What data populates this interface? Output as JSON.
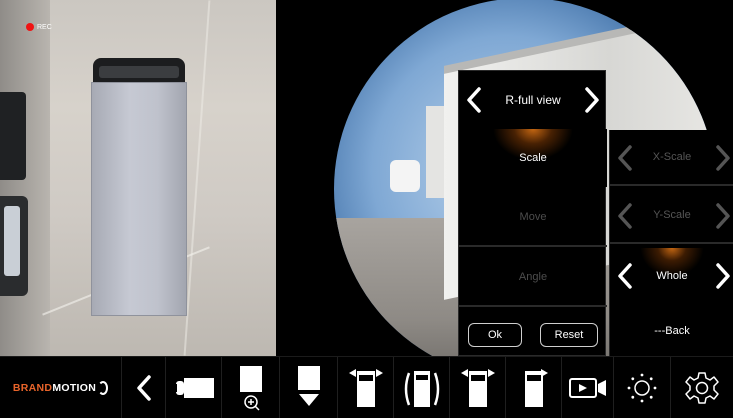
{
  "recording": {
    "label": "REC"
  },
  "menu": {
    "title": "R-full view",
    "items": [
      {
        "label": "Scale",
        "state": "selected"
      },
      {
        "label": "Move",
        "state": "disabled"
      },
      {
        "label": "Angle",
        "state": "disabled"
      }
    ],
    "ok_label": "Ok",
    "reset_label": "Reset"
  },
  "submenu": {
    "items": [
      {
        "label": "X-Scale",
        "state": "disabled"
      },
      {
        "label": "Y-Scale",
        "state": "disabled"
      },
      {
        "label": "Whole",
        "state": "selected"
      },
      {
        "label": "---Back",
        "state": "enabled"
      }
    ]
  },
  "toolbar": {
    "brand": {
      "part1": "BRAND",
      "part2": "MOTION"
    },
    "icons": [
      "back-chevron-icon",
      "rear-camera-icon",
      "zoom-in-icon",
      "down-view-icon",
      "front-corner-view-icon",
      "side-view-icon",
      "rear-corner-view-icon",
      "rear-view-icon",
      "record-video-icon",
      "brightness-icon",
      "settings-icon"
    ]
  },
  "colors": {
    "accent": "#c36612",
    "brand": "#e8642a",
    "rec": "#f01313",
    "disabled_text": "#4d4d4d"
  }
}
